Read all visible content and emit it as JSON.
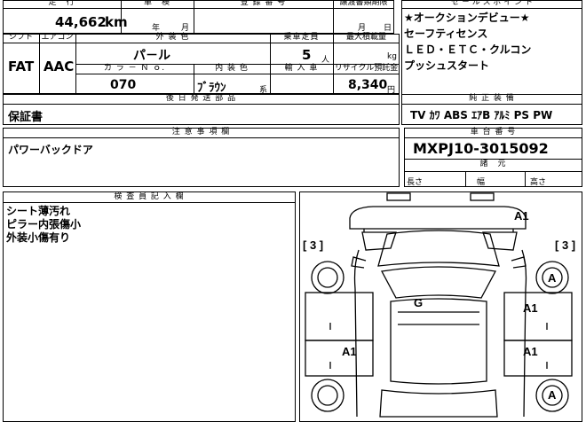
{
  "top": {
    "distance_label": "走　行",
    "distance_value": "44,662",
    "distance_unit": "km",
    "inspection_label": "車　検",
    "inspection_year_unit": "年",
    "inspection_month_unit": "月",
    "registration_label": "登 録 番 号",
    "transfer_label": "譲渡書類期限",
    "transfer_month_unit": "月",
    "transfer_day_unit": "日"
  },
  "row2": {
    "shift_label": "シフト",
    "shift_value": "FAT",
    "ac_label": "エアコン",
    "ac_value": "AAC",
    "exterior_label": "外 装 色",
    "exterior_value": "パ－ル",
    "capacity_label": "乗車定員",
    "capacity_value": "5",
    "capacity_unit": "人",
    "load_label": "最大積載量",
    "load_unit": "kg",
    "color_no_label": "カ ラ － Ｎ ｏ.",
    "color_no_value": "070",
    "interior_label": "内 装 色",
    "interior_value": "ﾌﾞﾗｳﾝ",
    "interior_unit": "系",
    "import_label": "輸 入 車",
    "recycle_label": "リサイクル預託金",
    "recycle_value": "8,340",
    "recycle_unit": "円"
  },
  "later_parts": {
    "label": "後 日 発 送 部 品",
    "value": "保証書"
  },
  "sales_point": {
    "label": "セ － ル ス ポ イ ン ト",
    "lines": [
      "★オークションデビュー★",
      "セーフティセンス",
      "ＬＥＤ・ＥＴＣ・クルコン",
      "プッシュスタート"
    ]
  },
  "genuine": {
    "label": "純 正 装 備",
    "value": "TV ｶﾜ ABS ｴｱB ｱﾙﾐ PS PW"
  },
  "notes": {
    "label": "注 意 事 項 欄",
    "value": "パワーバックドア"
  },
  "chassis": {
    "label": "車 台 番 号",
    "value": "MXPJ10-3015092"
  },
  "dimensions": {
    "label": "諸　元",
    "length_label": "長さ",
    "width_label": "幅",
    "height_label": "高さ"
  },
  "inspector": {
    "label": "検 査 員 記 入 欄",
    "lines": [
      "シート薄汚れ",
      "ピラー内張傷小",
      "外装小傷有り"
    ]
  },
  "diagram": {
    "marks": {
      "a1_top": "A1",
      "left_score": "[ 3 ]",
      "right_score": "[ 3 ]",
      "a_right_upper": "A",
      "a1_right_mid": "A1",
      "g_center": "G",
      "a1_left_lower": "A1",
      "a1_right_lower": "A1",
      "a_right_lower": "A"
    }
  }
}
